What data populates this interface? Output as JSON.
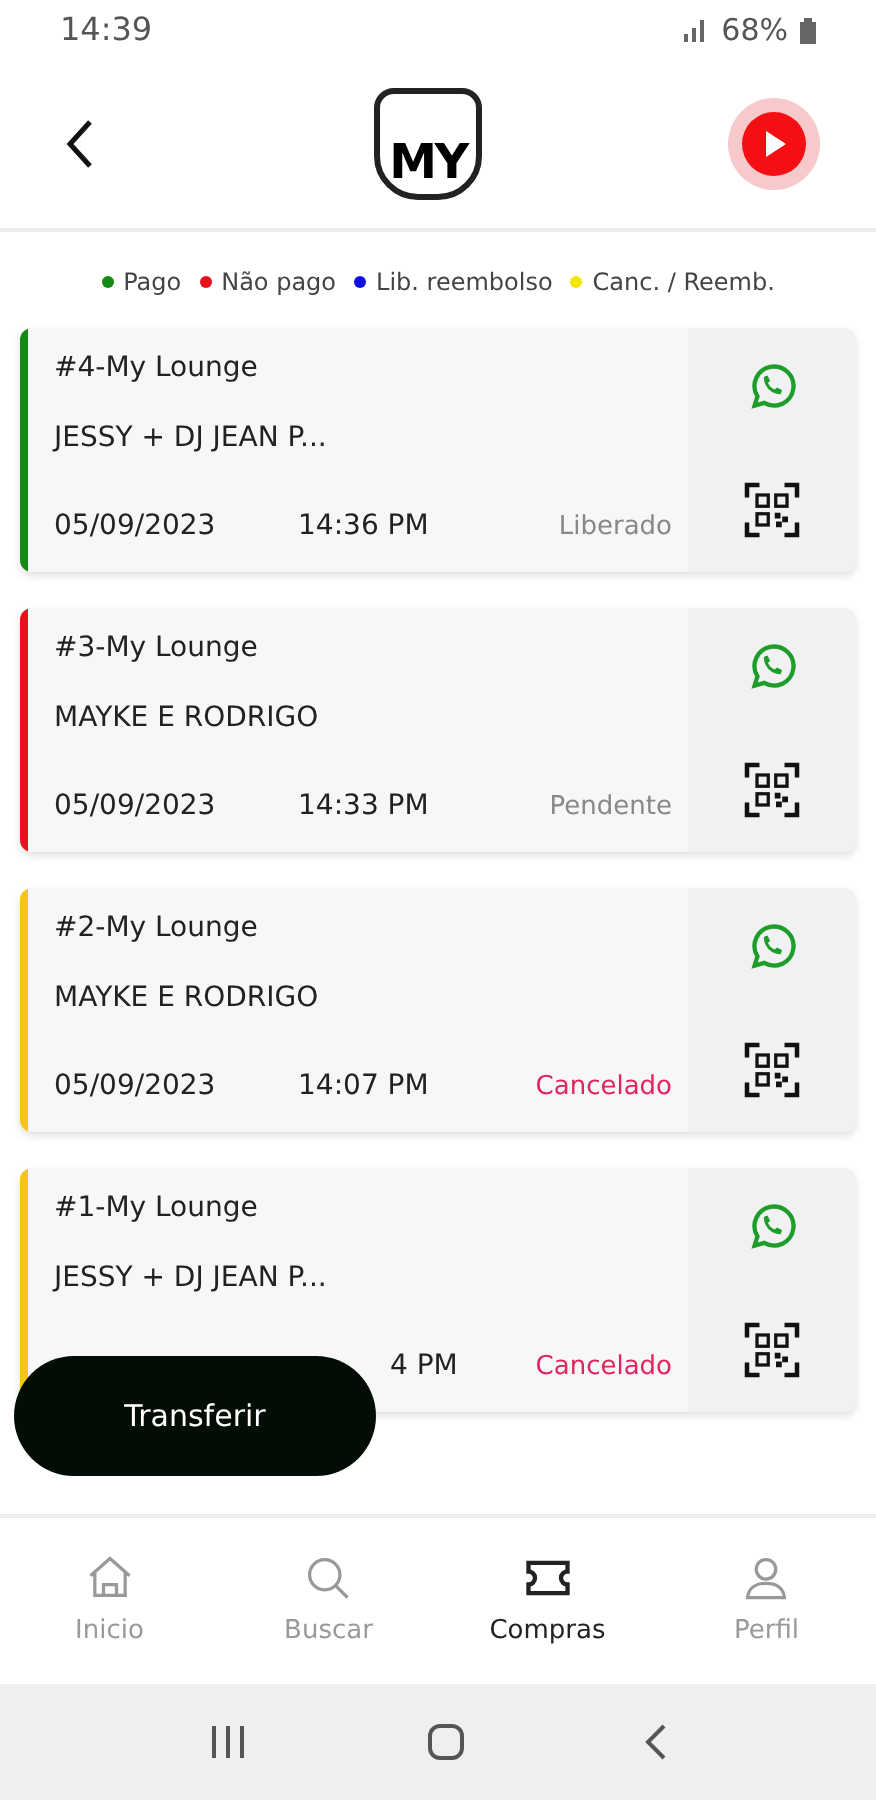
{
  "status_bar": {
    "time": "14:39",
    "battery": "68%"
  },
  "header": {
    "logo_text": "MY"
  },
  "legend": [
    {
      "label": "Pago",
      "color": "#138a13"
    },
    {
      "label": "Não pago",
      "color": "#e8101a"
    },
    {
      "label": "Lib. reembolso",
      "color": "#1010e0"
    },
    {
      "label": "Canc. / Reemb.",
      "color": "#f2e40c"
    }
  ],
  "purchases": [
    {
      "title": "#4-My Lounge",
      "name": "JESSY + DJ JEAN P...",
      "date": "05/09/2023",
      "time": "14:36 PM",
      "status": "Liberado",
      "status_alert": false,
      "color": "#138a13"
    },
    {
      "title": "#3-My Lounge",
      "name": "MAYKE E RODRIGO",
      "date": "05/09/2023",
      "time": "14:33 PM",
      "status": "Pendente",
      "status_alert": false,
      "color": "#e8101a"
    },
    {
      "title": "#2-My Lounge",
      "name": "MAYKE E RODRIGO",
      "date": "05/09/2023",
      "time": "14:07 PM",
      "status": "Cancelado",
      "status_alert": true,
      "color": "#f5c518"
    },
    {
      "title": "#1-My Lounge",
      "name": "JESSY + DJ JEAN P...",
      "time": "4 PM",
      "status": "Cancelado",
      "status_alert": true,
      "color": "#f5c518"
    }
  ],
  "transfer_button": {
    "label": "Transferir"
  },
  "bottom_nav": [
    {
      "label": "Inicio",
      "kind": "home",
      "selected": false
    },
    {
      "label": "Buscar",
      "kind": "search",
      "selected": false
    },
    {
      "label": "Compras",
      "kind": "ticket",
      "selected": true
    },
    {
      "label": "Perfil",
      "kind": "user",
      "selected": false
    }
  ]
}
